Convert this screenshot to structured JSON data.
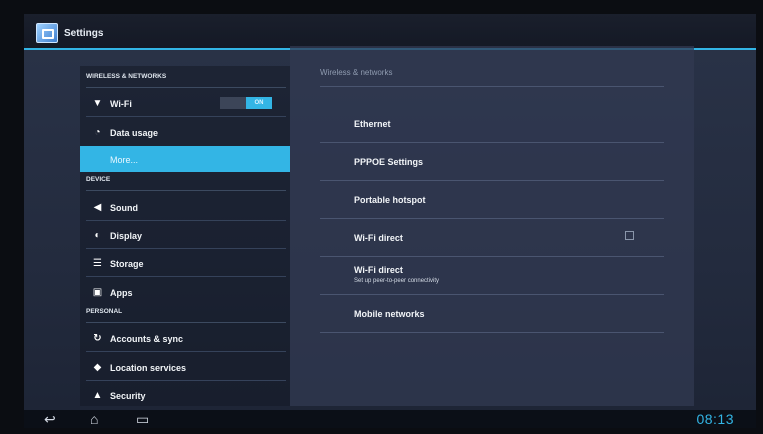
{
  "window": {
    "title": "Settings"
  },
  "colors": {
    "accent": "#33b5e5",
    "clock": "#33b5e5"
  },
  "sidebar": {
    "sections": [
      {
        "header": "WIRELESS & NETWORKS"
      },
      {
        "header": "DEVICE"
      },
      {
        "header": "PERSONAL"
      }
    ],
    "items": [
      {
        "label": "Wi-Fi",
        "icon": "wifi-icon",
        "toggle_label": "ON"
      },
      {
        "label": "Data usage",
        "icon": "data-usage-icon"
      },
      {
        "label": "More...",
        "icon": "",
        "selected": true
      },
      {
        "label": "Sound",
        "icon": "sound-icon"
      },
      {
        "label": "Display",
        "icon": "display-icon"
      },
      {
        "label": "Storage",
        "icon": "storage-icon"
      },
      {
        "label": "Apps",
        "icon": "apps-icon"
      },
      {
        "label": "Accounts & sync",
        "icon": "sync-icon"
      },
      {
        "label": "Location services",
        "icon": "location-icon"
      },
      {
        "label": "Security",
        "icon": "lock-icon"
      }
    ]
  },
  "main": {
    "header": "Wireless & networks",
    "rows": [
      {
        "title": "Ethernet"
      },
      {
        "title": "PPPOE Settings"
      },
      {
        "title": "Portable hotspot"
      },
      {
        "title": "Wi-Fi direct",
        "checkbox": false
      },
      {
        "title": "Wi-Fi direct",
        "subtitle": "Set up peer-to-peer connectivity"
      },
      {
        "title": "Mobile networks"
      }
    ]
  },
  "navbar": {
    "back_icon": "back-icon",
    "home_icon": "home-icon",
    "recents_icon": "recents-icon",
    "clock": "08:13"
  }
}
